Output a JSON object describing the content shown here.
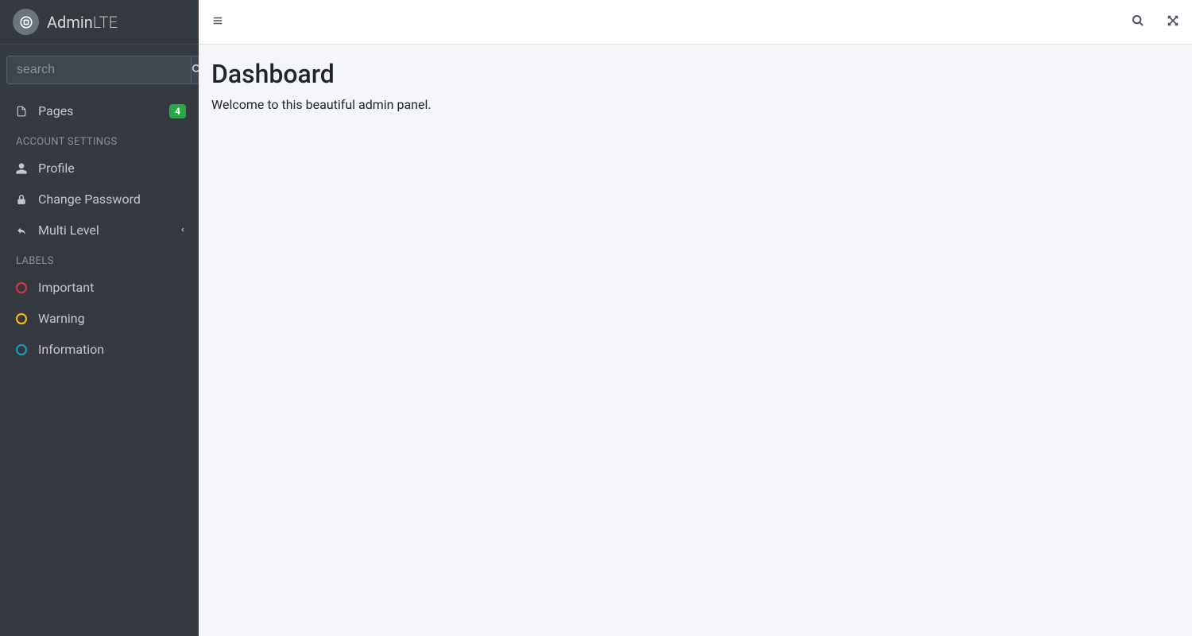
{
  "brand": {
    "text_bold": "Admin",
    "text_light": "LTE"
  },
  "sidebar": {
    "search_placeholder": "search",
    "nav": {
      "pages": {
        "label": "Pages",
        "badge": "4"
      }
    },
    "header_account": "ACCOUNT SETTINGS",
    "account": {
      "profile": {
        "label": "Profile"
      },
      "change_password": {
        "label": "Change Password"
      },
      "multi_level": {
        "label": "Multi Level"
      }
    },
    "header_labels": "LABELS",
    "labels": {
      "important": {
        "label": "Important",
        "color": "#dc3545"
      },
      "warning": {
        "label": "Warning",
        "color": "#ffc107"
      },
      "information": {
        "label": "Information",
        "color": "#17a2b8"
      }
    }
  },
  "main": {
    "title": "Dashboard",
    "description": "Welcome to this beautiful admin panel."
  }
}
